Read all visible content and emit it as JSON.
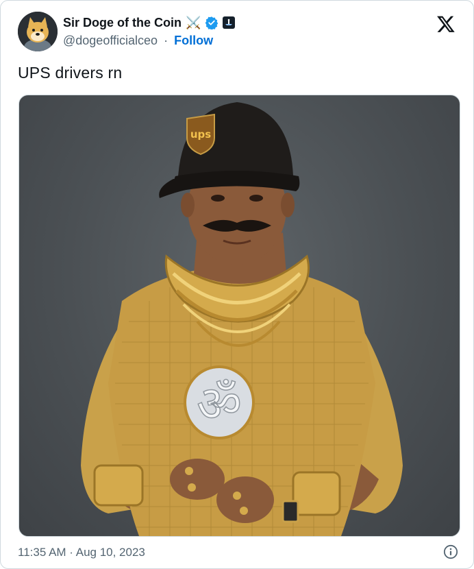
{
  "tweet": {
    "author": {
      "display_name": "Sir Doge of the Coin",
      "name_emoji": "⚔️",
      "handle": "@dogeofficialceo",
      "separator": "·",
      "follow_label": "Follow",
      "avatar_icon": "doge-avatar-icon",
      "verified_icon": "verified-badge-icon",
      "affiliation_icon": "affiliation-badge-icon"
    },
    "platform_icon": "x-logo-icon",
    "text": "UPS drivers rn",
    "media": {
      "cap_logo_text": "ups",
      "pendant_text": "ॐ"
    },
    "timestamp": "11:35 AM · Aug 10, 2023",
    "info_icon": "info-icon"
  },
  "colors": {
    "link_blue": "#006fd6",
    "verified_blue": "#1d9bf0",
    "secondary_text": "#536471",
    "gold": "#c9a14a"
  }
}
